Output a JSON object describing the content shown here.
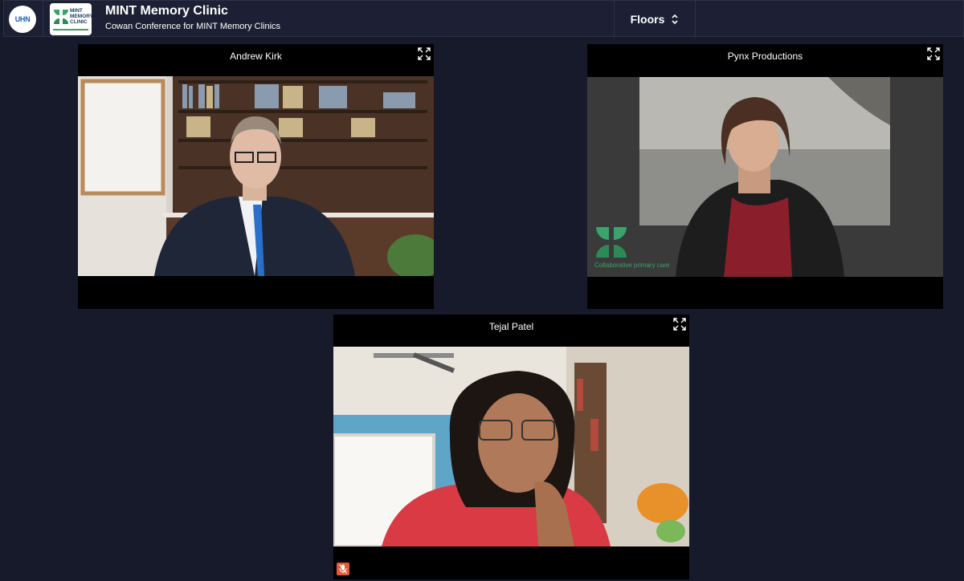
{
  "header": {
    "title": "MINT Memory Clinic",
    "subtitle": "Cowan Conference for MINT Memory Clinics",
    "org_logo_text": "UHN",
    "mint_logo_text": "MINT MEMORY CLINIC",
    "floors_label": "Floors"
  },
  "participants": [
    {
      "name": "Andrew Kirk",
      "muted": false
    },
    {
      "name": "Pynx Productions",
      "muted": false,
      "watermark": "Collaborative primary care"
    },
    {
      "name": "Tejal Patel",
      "muted": true
    }
  ],
  "colors": {
    "background": "#171a2b",
    "topbar": "#1d2034",
    "tile": "#000000",
    "mute_badge": "#e05a3a",
    "brand_green": "#3aa36b"
  }
}
